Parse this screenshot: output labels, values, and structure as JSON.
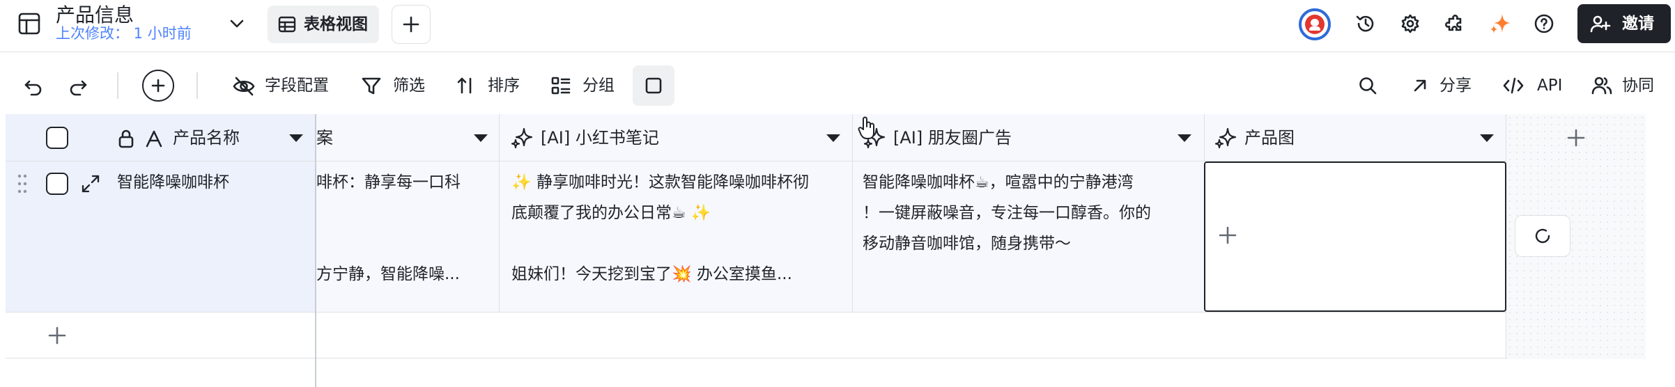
{
  "header": {
    "title": "产品信息",
    "subtitle": "上次修改： 1 小时前",
    "view_tab_label": "表格视图",
    "invite_label": "邀请"
  },
  "toolbar": {
    "field_config": "字段配置",
    "filter": "筛选",
    "sort": "排序",
    "group": "分组",
    "share": "分享",
    "api": "API",
    "collab": "协同"
  },
  "table": {
    "columns": [
      {
        "label": "产品名称",
        "icon": "text-field-icon",
        "locked": true
      },
      {
        "label": "案",
        "icon": "none"
      },
      {
        "label": "[AI] 小红书笔记",
        "icon": "ai-sparkle-icon"
      },
      {
        "label": "[AI] 朋友圈广告",
        "icon": "ai-sparkle-icon"
      },
      {
        "label": "产品图",
        "icon": "ai-sparkle-icon"
      }
    ],
    "row": {
      "name": "智能降噪咖啡杯",
      "copy_line1": "啡杯：静享每一口科",
      "copy_line2": "方宁静，智能降噪...",
      "xhs_line1": "✨ 静享咖啡时光！这款智能降噪咖啡杯彻",
      "xhs_line2": "底颠覆了我的办公日常☕ ✨",
      "xhs_line3": "姐妹们！今天挖到宝了💥 办公室摸鱼...",
      "moments_line1": "智能降噪咖啡杯☕，喧嚣中的宁静港湾",
      "moments_line2": "！一键屏蔽噪音，专注每一口醇香。你的",
      "moments_line3": "移动静音咖啡馆，随身携带～"
    }
  },
  "colors": {
    "accent": "#4e83fd",
    "ai_orange": "#ff7d2e",
    "frozen_bg": "#edf1fb",
    "cell_bg": "#f6f8fd",
    "dark_button": "#1f2329"
  }
}
